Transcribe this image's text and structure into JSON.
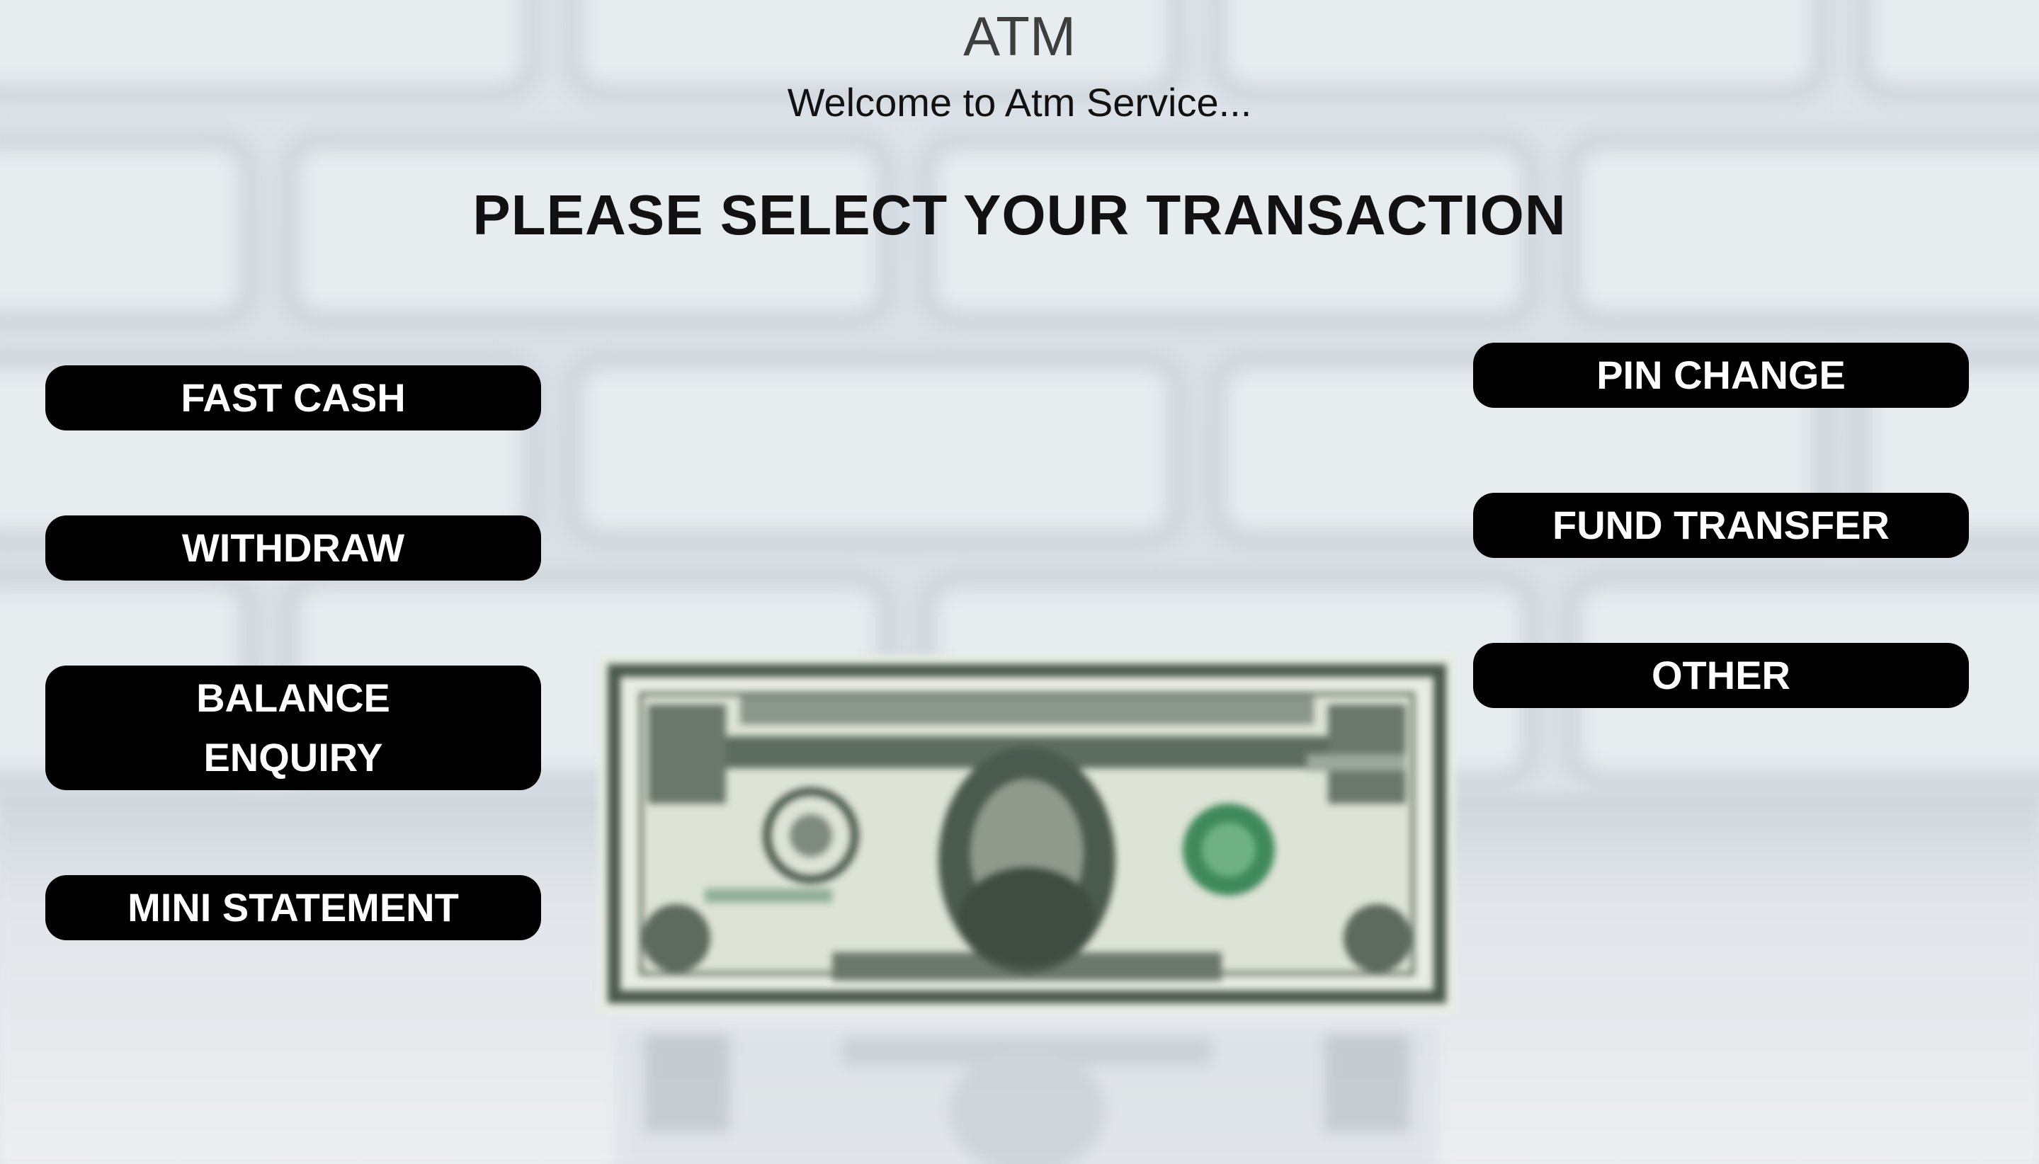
{
  "header": {
    "title": "ATM",
    "subtitle": "Welcome to Atm Service..."
  },
  "prompt": "PLEASE SELECT YOUR TRANSACTION",
  "buttons": {
    "fast_cash": "FAST CASH",
    "withdraw": "WITHDRAW",
    "balance_enquiry_line1": "BALANCE",
    "balance_enquiry_line2": "ENQUIRY",
    "mini_statement": "MINI STATEMENT",
    "pin_change": "PIN CHANGE",
    "fund_transfer": "FUND TRANSFER",
    "other": "OTHER"
  },
  "colors": {
    "button_bg": "#000000",
    "button_text": "#ffffff",
    "heading_text": "#111111",
    "title_text": "#3e3e3e",
    "wall": "#dfe5ea",
    "bill_green": "#5f7f63"
  },
  "background": {
    "image": "dollar-bill-on-table-photo"
  }
}
